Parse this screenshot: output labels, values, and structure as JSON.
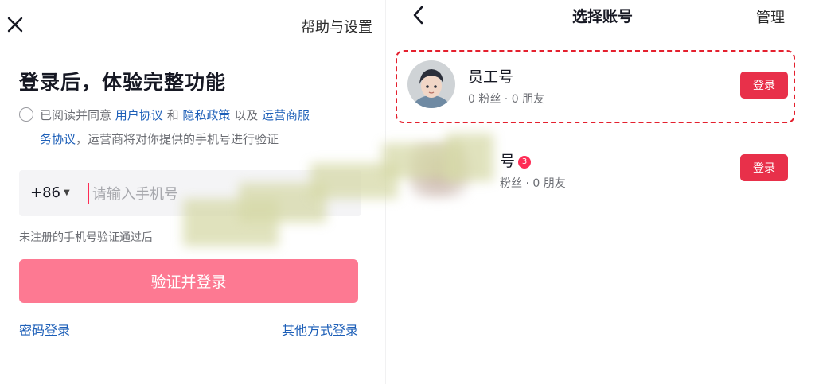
{
  "left": {
    "help_settings": "帮助与设置",
    "title": "登录后，体验完整功能",
    "agreement": {
      "prefix": "已阅读并同意",
      "user_agreement": "用户协议",
      "and": "和",
      "privacy_policy": "隐私政策",
      "also": "以及",
      "carrier_part1": "运营商服",
      "carrier_part2": "务协议",
      "suffix": "，运营商将对你提供的手机号进行验证"
    },
    "country_code": "+86",
    "phone_placeholder": "请输入手机号",
    "hint": "未注册的手机号验证通过后",
    "primary_button": "验证并登录",
    "password_login": "密码登录",
    "other_login": "其他方式登录"
  },
  "right": {
    "title": "选择账号",
    "manage": "管理",
    "accounts": [
      {
        "name": "员工号",
        "stats": "0 粉丝 · 0 朋友",
        "button": "登录",
        "highlighted": true
      },
      {
        "name": "号",
        "badge": "3",
        "stats": "粉丝 · 0 朋友",
        "button": "登录",
        "highlighted": false
      }
    ]
  },
  "colors": {
    "accent": "#fe2c55",
    "primary_button": "#fd7992",
    "login_button": "#e8304a",
    "link": "#1d5fb8",
    "highlight_border": "#e4202e"
  },
  "icons": {
    "close": "close-icon",
    "back": "chevron-left-icon",
    "caret": "caret-down-icon",
    "radio": "radio-unchecked-icon"
  }
}
